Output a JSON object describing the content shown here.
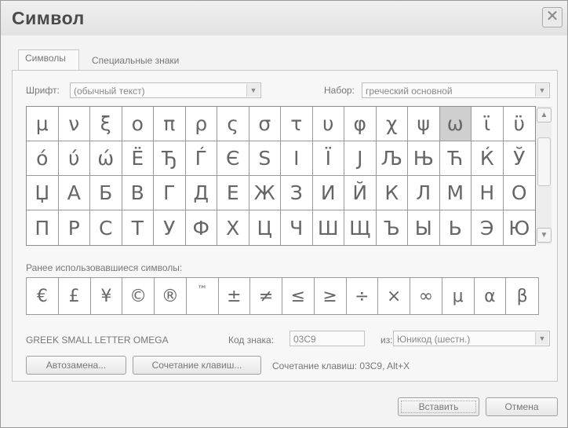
{
  "window": {
    "title": "Символ",
    "close_icon": "close-icon"
  },
  "tabs": [
    {
      "label": "Символы",
      "active": true
    },
    {
      "label": "Специальные знаки",
      "active": false
    }
  ],
  "font": {
    "label": "Шрифт:",
    "value": "(обычный текст)"
  },
  "subset": {
    "label": "Набор:",
    "value": "греческий основной"
  },
  "symbols": [
    [
      "μ",
      "ν",
      "ξ",
      "ο",
      "π",
      "ρ",
      "ς",
      "σ",
      "τ",
      "υ",
      "φ",
      "χ",
      "ψ",
      "ω",
      "ϊ",
      "ϋ"
    ],
    [
      "ό",
      "ύ",
      "ώ",
      "Ё",
      "Ђ",
      "Ѓ",
      "Є",
      "Ѕ",
      "І",
      "Ї",
      "Ј",
      "Љ",
      "Њ",
      "Ћ",
      "Ќ",
      "Ў"
    ],
    [
      "Џ",
      "А",
      "Б",
      "В",
      "Г",
      "Д",
      "Е",
      "Ж",
      "З",
      "И",
      "Й",
      "К",
      "Л",
      "М",
      "Н",
      "О"
    ],
    [
      "П",
      "Р",
      "С",
      "Т",
      "У",
      "Ф",
      "Х",
      "Ц",
      "Ч",
      "Ш",
      "Щ",
      "Ъ",
      "Ы",
      "Ь",
      "Э",
      "Ю"
    ]
  ],
  "selected_symbol": "ω",
  "recent": {
    "label": "Ранее использовавшиеся символы:",
    "items": [
      "€",
      "£",
      "¥",
      "©",
      "®",
      "™",
      "±",
      "≠",
      "≤",
      "≥",
      "÷",
      "×",
      "∞",
      "μ",
      "α",
      "β"
    ]
  },
  "char_name": "GREEK SMALL LETTER OMEGA",
  "char_code": {
    "label": "Код знака:",
    "value": "03C9"
  },
  "from": {
    "label": "из:",
    "value": "Юникод (шестн.)"
  },
  "buttons": {
    "autocorrect": "Автозамена...",
    "shortcut_key": "Сочетание клавиш...",
    "shortcut_text": "Сочетание клавиш: 03C9, Alt+X",
    "insert": "Вставить",
    "cancel": "Отмена"
  }
}
